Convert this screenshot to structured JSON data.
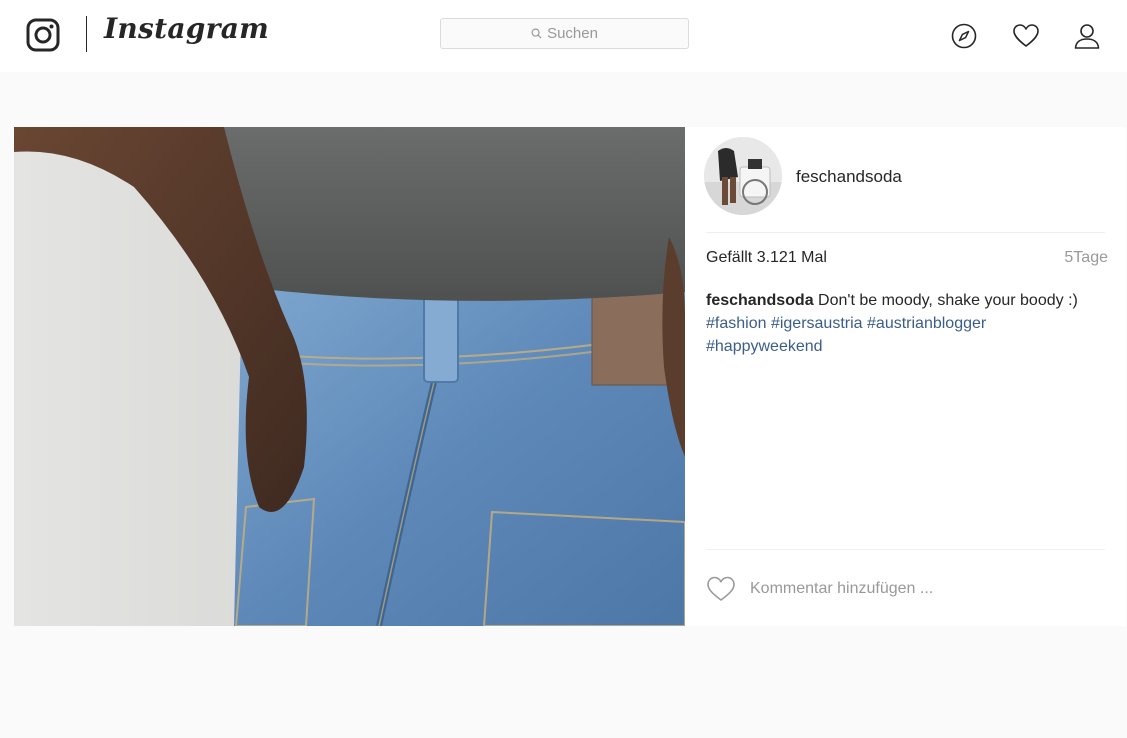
{
  "header": {
    "brand": "Instagram",
    "search": {
      "label": "Suchen"
    },
    "icons": [
      "compass-icon",
      "heart-icon",
      "profile-icon"
    ]
  },
  "post": {
    "username": "feschandsoda",
    "likes": "Gefällt 3.121 Mal",
    "age": "5Tage",
    "caption": {
      "author": "feschandsoda",
      "text": "Don't be moody, shake your boody :)",
      "hashtags": [
        "#fashion",
        "#igersaustria",
        "#austrianblogger",
        "#happyweekend"
      ]
    },
    "comment_placeholder": "Kommentar hinzufügen ..."
  },
  "colors": {
    "background": "#fafafa",
    "text": "#262626",
    "muted": "#999999",
    "hashtag": "#3b5d8a",
    "border": "#dbdbdb"
  }
}
